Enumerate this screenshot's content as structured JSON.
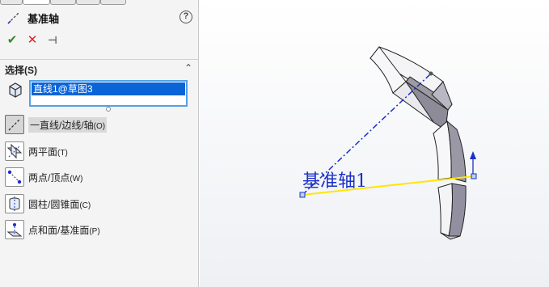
{
  "feature": {
    "title": "基准轴",
    "help_icon": "?"
  },
  "actions": {
    "ok_icon": "✔",
    "cancel_icon": "✕",
    "pin_icon": "⊣"
  },
  "selection": {
    "section_title": "选择(S)",
    "collapse_icon": "⌃",
    "selected_item": "直线1@草图3"
  },
  "options": [
    {
      "label": "一直线/边线/轴",
      "key": "(O)",
      "icon": "line-edge-axis-icon",
      "selected": true
    },
    {
      "label": "两平面",
      "key": "(T)",
      "icon": "two-planes-icon",
      "selected": false
    },
    {
      "label": "两点/顶点",
      "key": "(W)",
      "icon": "two-points-icon",
      "selected": false
    },
    {
      "label": "圆柱/圆锥面",
      "key": "(C)",
      "icon": "cylinder-cone-icon",
      "selected": false
    },
    {
      "label": "点和面/基准面",
      "key": "(P)",
      "icon": "point-plane-icon",
      "selected": false
    }
  ],
  "viewport": {
    "axis_label": "基准轴1"
  },
  "colors": {
    "selection_highlight": "#0a64d8",
    "selection_border": "#52a0e8",
    "axis_line": "#ffe600",
    "axis_label": "#1b2fc8",
    "sketch_line": "#1b2fc8",
    "ok_color": "#2e8b2e",
    "cancel_color": "#dd2222"
  }
}
